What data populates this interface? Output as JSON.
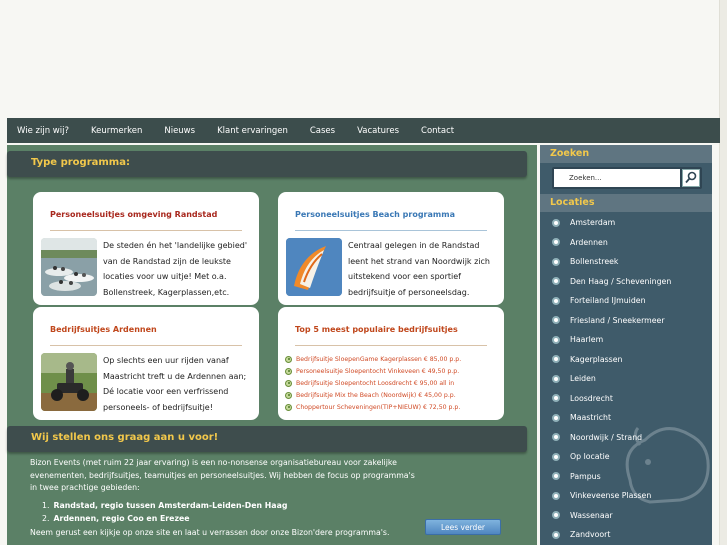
{
  "nav": {
    "items": [
      "Wie zijn wij?",
      "Keurmerken",
      "Nieuws",
      "Klant ervaringen",
      "Cases",
      "Vacatures",
      "Contact"
    ]
  },
  "sections": {
    "type_programma": "Type programma:",
    "wij_stellen": "Wij stellen ons graag aan u voor!"
  },
  "cards": {
    "randstad": {
      "title": "Personeelsuitjes omgeving Randstad",
      "text": "De steden én het 'landelijke gebied' van de Randstad zijn de leukste locaties voor uw uitje! Met o.a. Bollenstreek, Kagerplassen,etc."
    },
    "beach": {
      "title": "Personeelsuitjes Beach programma",
      "text": "Centraal gelegen in de Randstad leent het strand van Noordwijk zich uitstekend voor een sportief bedrijfsuitje of personeelsdag."
    },
    "ardennen": {
      "title": "Bedrijfsuitjes Ardennen",
      "text": "Op slechts een uur rijden vanaf Maastricht treft u de Ardennen aan; Dé locatie voor een verfrissend personeels- of bedrijfsuitje!"
    },
    "top5": {
      "title": "Top 5 meest populaire bedrijfsuitjes",
      "items": [
        "Bedrijfsuitje SloepenGame Kagerplassen € 85,00 p.p.",
        "Personeelsuitje Sloepentocht Vinkeveen € 49,50 p.p.",
        "Bedrijfsuitje Sloepentocht Loosdrecht € 95,00 all in",
        "Bedrijfsuitje Mix the Beach (Noordwijk) € 45,00 p.p.",
        "Choppertour Scheveningen(TIP+NIEUW) € 72,50 p.p."
      ]
    }
  },
  "intro": {
    "text": "Bizon Events (met ruim 22 jaar ervaring) is een no-nonsense organisatiebureau voor zakelijke evenementen, bedrijfsuitjes, teamuitjes en personeelsuitjes. Wij hebben de focus op programma's in twee prachtige gebieden:",
    "list": [
      "Randstad, regio tussen Amsterdam-Leiden-Den Haag",
      "Ardennen, regio Coo en Erezee"
    ],
    "outro": "Neem gerust een kijkje op onze site en laat u verrassen door onze Bizon'dere programma's.",
    "read_more": "Lees verder"
  },
  "sidebar": {
    "search_title": "Zoeken",
    "search_value": "Zoeken...",
    "locations_title": "Locaties",
    "locations": [
      "Amsterdam",
      "Ardennen",
      "Bollenstreek",
      "Den Haag / Scheveningen",
      "Forteiland IJmuiden",
      "Friesland / Sneekermeer",
      "Haarlem",
      "Kagerplassen",
      "Leiden",
      "Loosdrecht",
      "Maastricht",
      "Noordwijk / Strand",
      "Op locatie",
      "Pampus",
      "Vinkeveense Plassen",
      "Wassenaar",
      "Zandvoort"
    ]
  },
  "colors": {
    "nav_bg": "#3c4d4c",
    "main_bg": "#5b8066",
    "section_title": "#f2c84b",
    "card_title_red": "#a8281e",
    "card_title_blue": "#3a78b5",
    "card_title_orange": "#c0471c",
    "sidebar_bg": "#3f5b6a"
  }
}
